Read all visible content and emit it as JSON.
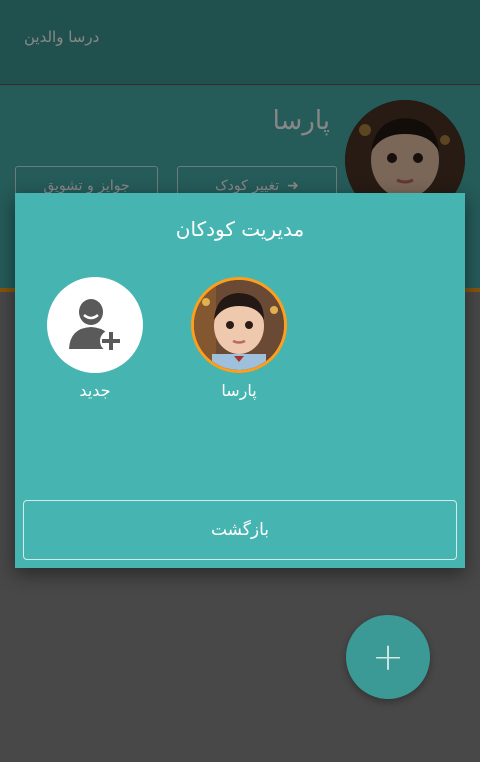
{
  "app": {
    "title": "درسا والدین"
  },
  "profile": {
    "name": "پارسا",
    "button_left_label": "جوایز و تشویق",
    "button_right_label": "تغییر کودک",
    "arrow_icon": "arrow-right-icon"
  },
  "dialog": {
    "title": "مدیریت کودکان",
    "children": [
      {
        "name": "پارسا",
        "selected": true
      },
      {
        "name": "جدید",
        "icon": "add-user-icon"
      }
    ],
    "back_label": "بازگشت"
  },
  "fab": {
    "icon": "plus-icon",
    "label": "+"
  },
  "colors": {
    "teal_dark": "#3f9a96",
    "teal": "#46b5b1",
    "accent_orange": "#ff9e1b",
    "white": "#ffffff"
  }
}
